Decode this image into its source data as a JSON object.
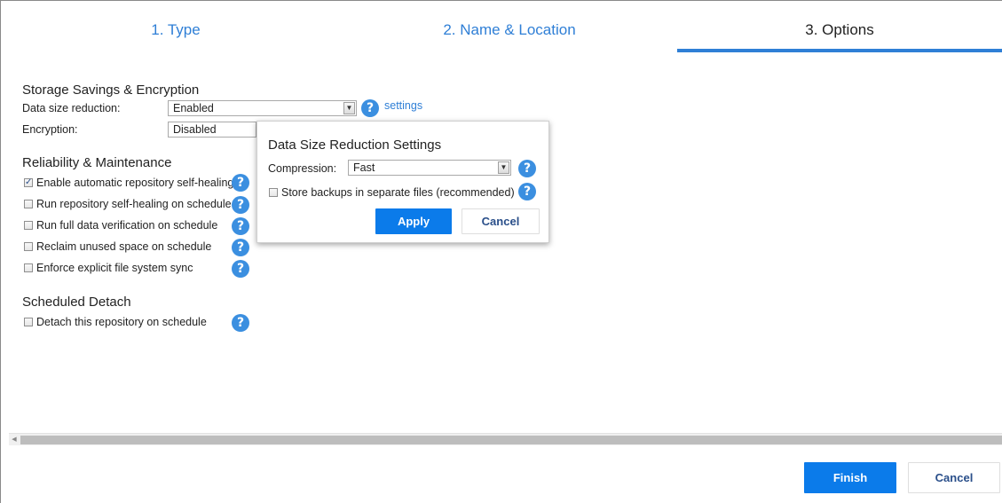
{
  "tabs": [
    {
      "label": "1. Type"
    },
    {
      "label": "2. Name & Location"
    },
    {
      "label": "3. Options"
    }
  ],
  "storage": {
    "title": "Storage Savings & Encryption",
    "data_size_label": "Data size reduction:",
    "data_size_value": "Enabled",
    "settings_link": "settings",
    "encryption_label": "Encryption:",
    "encryption_value": "Disabled"
  },
  "reliability": {
    "title": "Reliability & Maintenance",
    "items": [
      {
        "label": "Enable automatic repository self-healing",
        "checked": true
      },
      {
        "label": "Run repository self-healing on schedule",
        "checked": false
      },
      {
        "label": "Run full data verification on schedule",
        "checked": false
      },
      {
        "label": "Reclaim unused space on schedule",
        "checked": false
      },
      {
        "label": "Enforce explicit file system sync",
        "checked": false
      }
    ]
  },
  "detach": {
    "title": "Scheduled Detach",
    "item": {
      "label": "Detach this repository on schedule",
      "checked": false
    }
  },
  "popup": {
    "title": "Data Size Reduction Settings",
    "compression_label": "Compression:",
    "compression_value": "Fast",
    "separate_files_label": "Store backups in separate files (recommended)",
    "apply_label": "Apply",
    "cancel_label": "Cancel"
  },
  "footer": {
    "finish_label": "Finish",
    "cancel_label": "Cancel"
  },
  "icons": {
    "help": "question-circle-icon",
    "dropdown": "chevron-down-icon",
    "scroll_left": "arrow-left-icon"
  },
  "colors": {
    "accent": "#2f7fd6",
    "primary_button": "#0b7bea",
    "help_icon": "#3b8fe0"
  }
}
